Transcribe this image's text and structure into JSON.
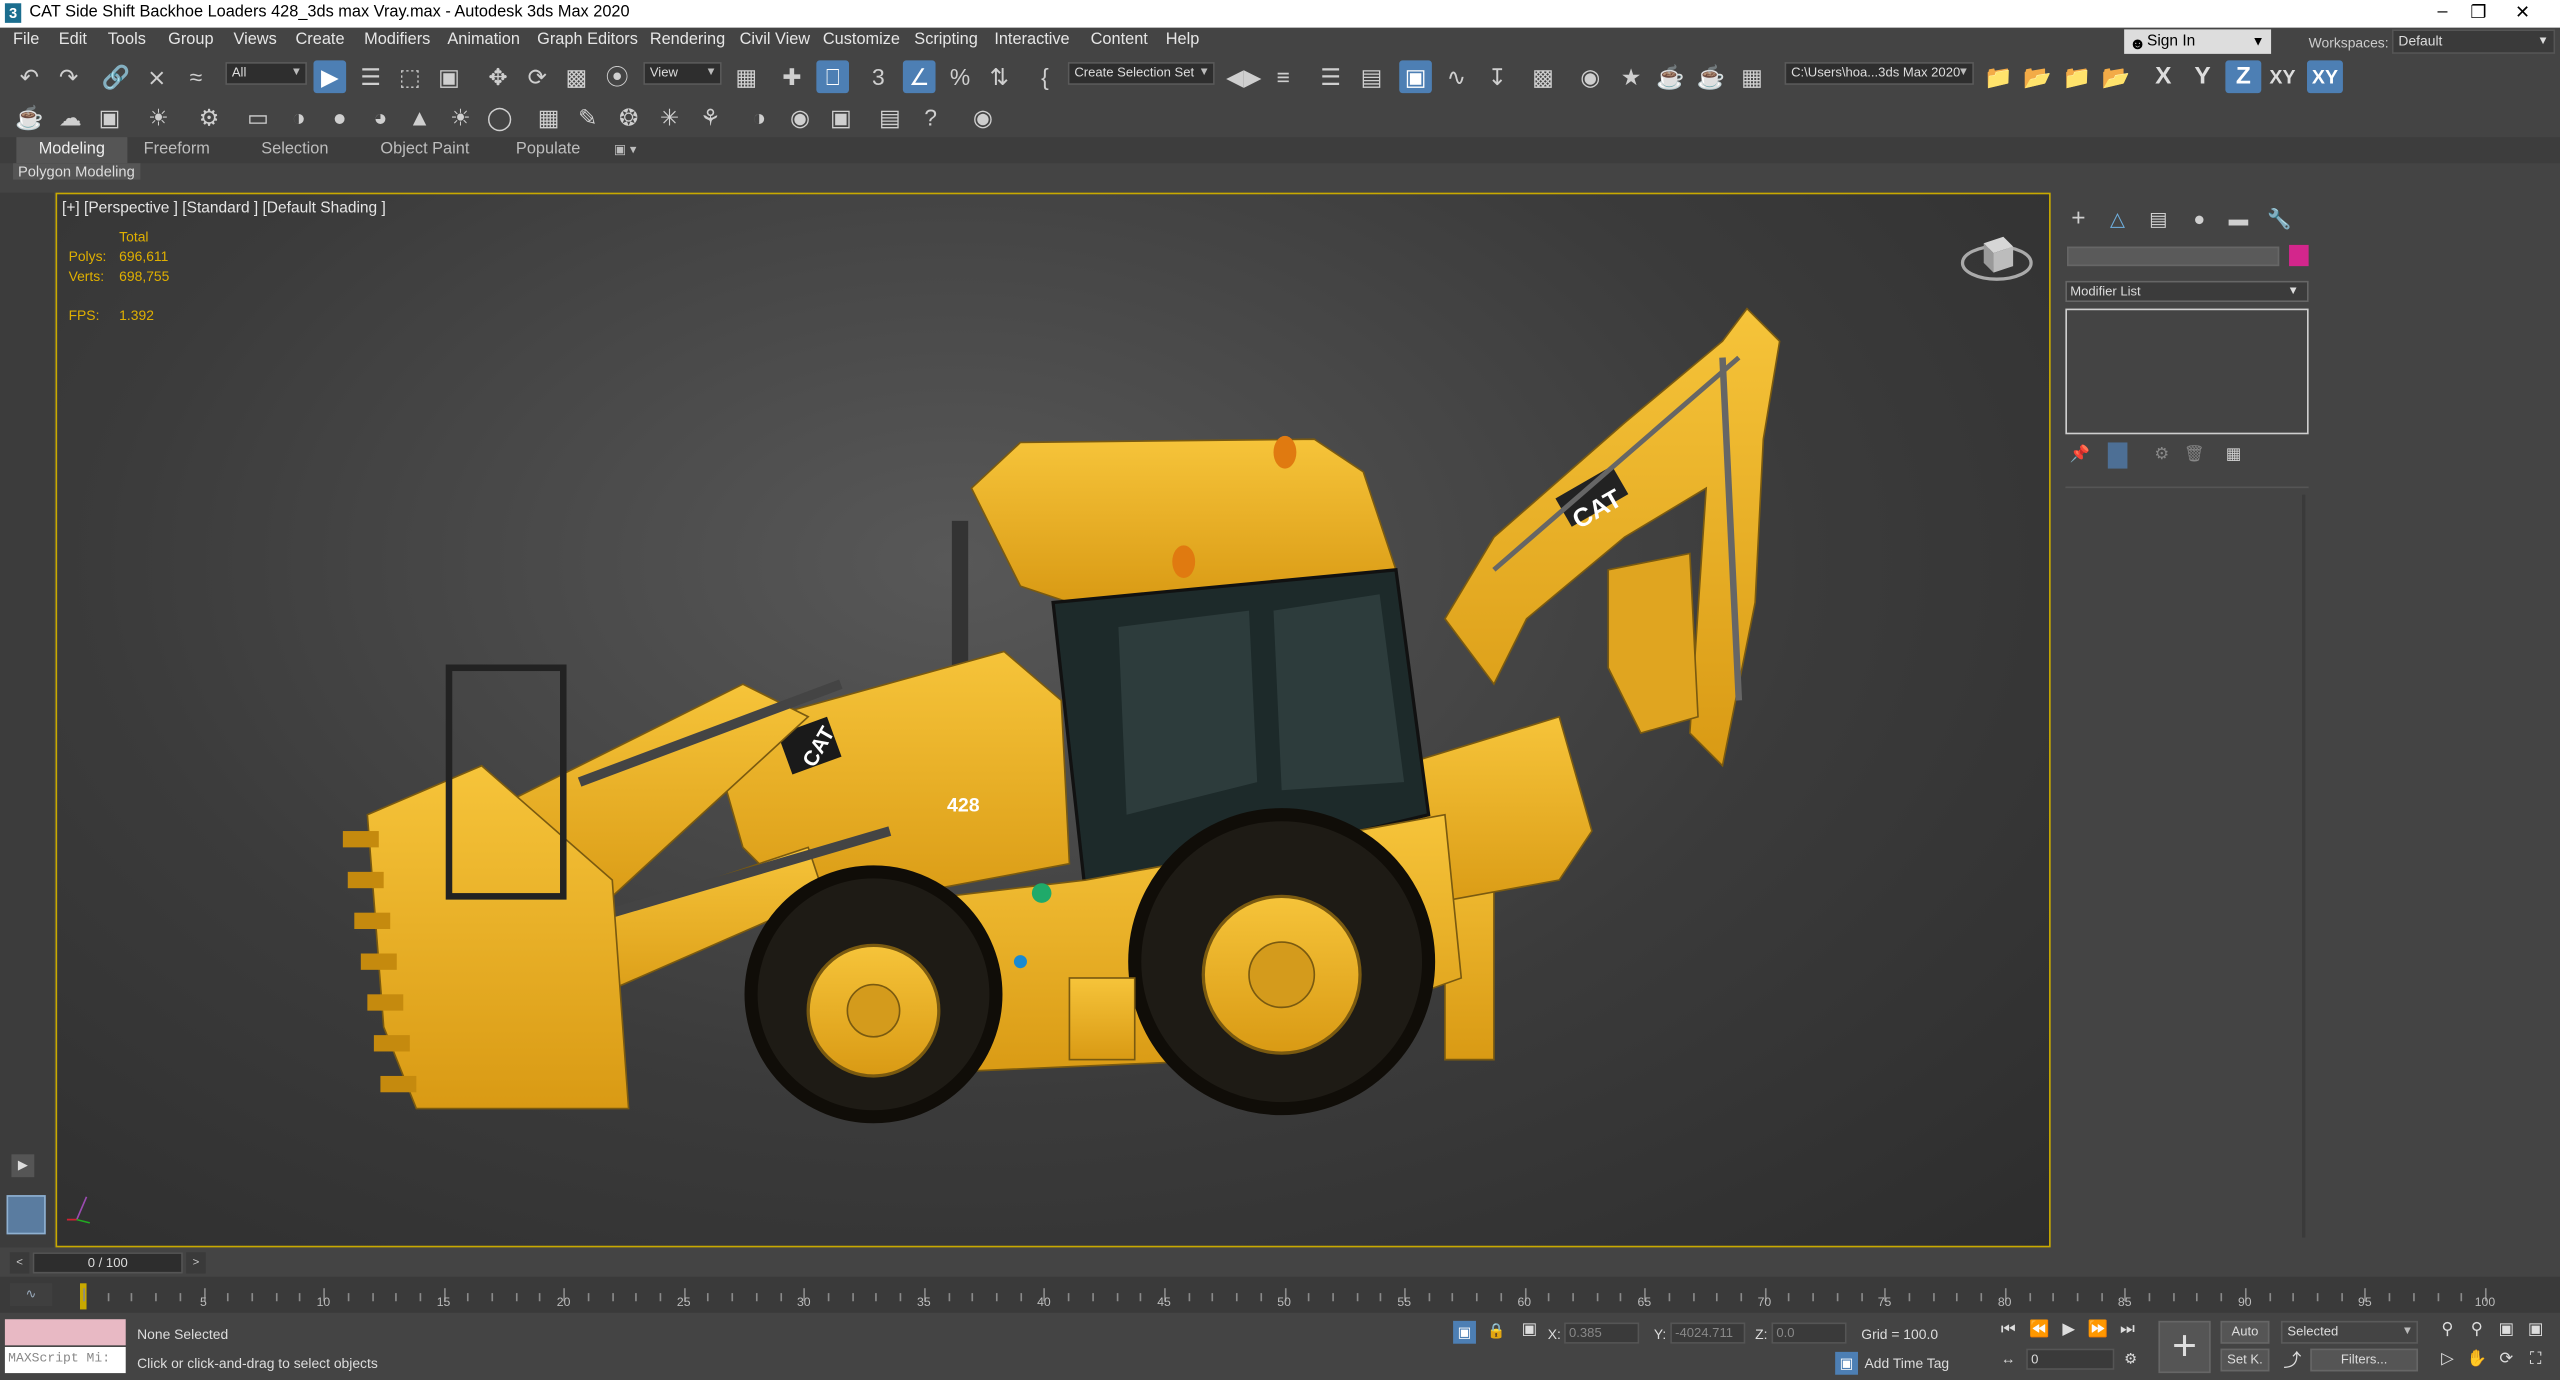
{
  "window": {
    "title": "CAT Side Shift Backhoe Loaders 428_3ds max Vray.max - Autodesk 3ds Max 2020",
    "logo": "3",
    "controls": [
      "minimize-icon",
      "restore-icon",
      "close-icon"
    ]
  },
  "menu": {
    "items": [
      "File",
      "Edit",
      "Tools",
      "Group",
      "Views",
      "Create",
      "Modifiers",
      "Animation",
      "Graph Editors",
      "Rendering",
      "Civil View",
      "Customize",
      "Scripting",
      "Interactive",
      "Content",
      "Help"
    ],
    "signin": "Sign In",
    "workspaces_label": "Workspaces:",
    "workspaces_value": "Default"
  },
  "toolbar": {
    "selection_filter": "All",
    "ref_coord": "View",
    "named_selection": "Create Selection Set",
    "project_path": "C:\\Users\\hoa...3ds Max 2020",
    "axes": [
      "X",
      "Y",
      "Z",
      "XY",
      "XY"
    ]
  },
  "ribbon": {
    "tabs": [
      "Modeling",
      "Freeform",
      "Selection",
      "Object Paint",
      "Populate"
    ],
    "active_tab": "Modeling",
    "sub_label": "Polygon Modeling"
  },
  "viewport": {
    "label": "[+] [Perspective ] [Standard ] [Default Shading ]",
    "stats": {
      "total_label": "Total",
      "polys_label": "Polys:",
      "polys_value": "696,611",
      "verts_label": "Verts:",
      "verts_value": "698,755",
      "fps_label": "FPS:",
      "fps_value": "1.392"
    },
    "badge_text": "CAT",
    "model_number": "428"
  },
  "command_panel": {
    "modifier_list": "Modifier List",
    "object_color": "#d3268c"
  },
  "timeslider": {
    "value": "0 / 100",
    "ticks": [
      "5",
      "10",
      "15",
      "20",
      "25",
      "30",
      "35",
      "40",
      "45",
      "50",
      "55",
      "60",
      "65",
      "70",
      "75",
      "80",
      "85",
      "90",
      "95",
      "100"
    ]
  },
  "status": {
    "maxscript": "MAXScript Mi:",
    "selection": "None Selected",
    "prompt": "Click or click-and-drag to select objects",
    "x_label": "X:",
    "x_value": "0.385",
    "y_label": "Y:",
    "y_value": "-4024.711",
    "z_label": "Z:",
    "z_value": "0.0",
    "grid": "Grid = 100.0",
    "add_time_tag": "Add Time Tag",
    "auto_key": "Auto",
    "set_key": "Set K.",
    "key_filter": "Selected",
    "filters": "Filters...",
    "frame": "0"
  },
  "colors": {
    "accent": "#4d7fb4",
    "viewport_border": "#c8a900",
    "stats": "#e0b000",
    "machine": "#e8ad1c"
  }
}
